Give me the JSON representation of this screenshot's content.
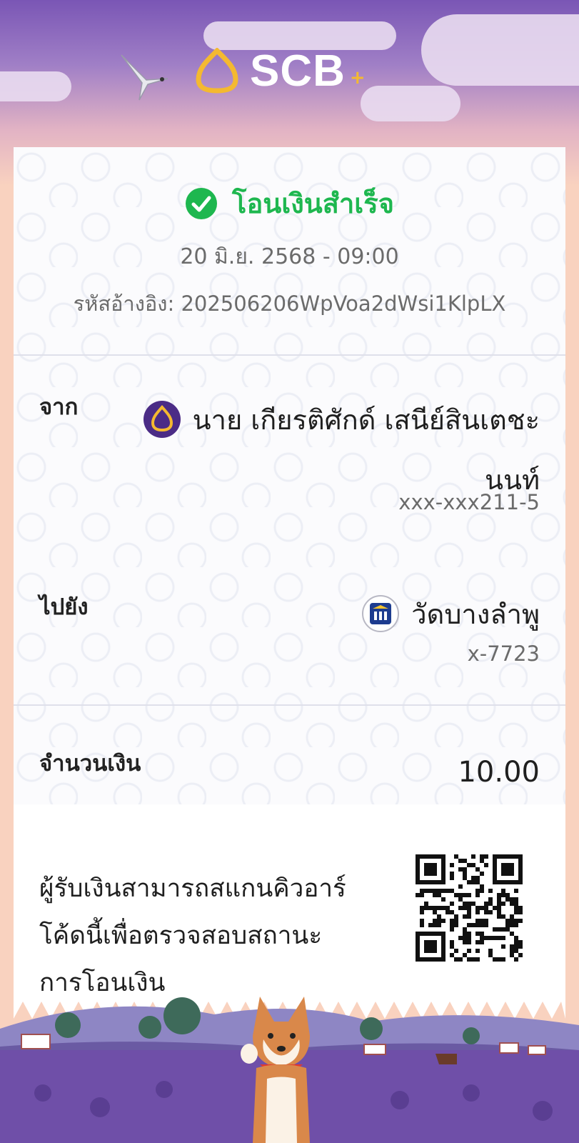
{
  "header": {
    "brand": "SCB",
    "plus": "+"
  },
  "receipt": {
    "status": "โอนเงินสำเร็จ",
    "datetime": "20 มิ.ย. 2568 - 09:00",
    "ref_label": "รหัสอ้างอิง:",
    "ref_code": "202506206WpVoa2dWsi1KlpLX"
  },
  "from": {
    "label": "จาก",
    "name_line1": "นาย เกียรติศักด์ เสนีย์สินเตชะ",
    "name_line2": "นนท์",
    "account": "xxx-xxx211-5"
  },
  "to": {
    "label": "ไปยัง",
    "name": "วัดบางลำพู",
    "account": "x-7723"
  },
  "amount": {
    "label": "จำนวนเงิน",
    "value": "10.00"
  },
  "qr_note": {
    "line1": "ผู้รับเงินสามารถสแกนคิวอาร์",
    "line2": "โค้ดนี้เพื่อตรวจสอบสถานะ",
    "line3": "การโอนเงิน"
  },
  "colors": {
    "success": "#1eb74f",
    "brand_purple": "#4b2c86",
    "brand_gold": "#f4b930"
  }
}
